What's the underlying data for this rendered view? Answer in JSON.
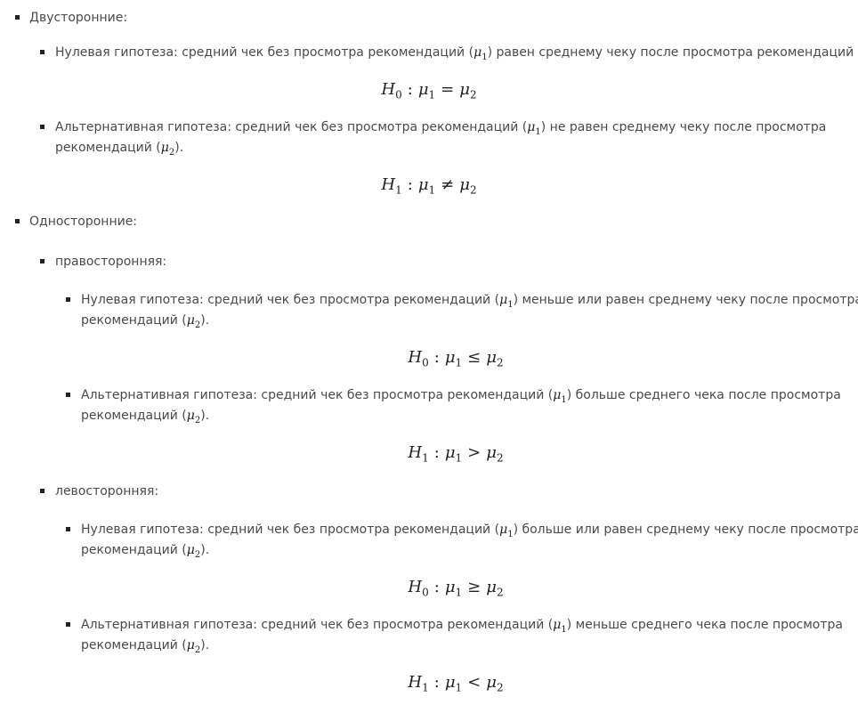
{
  "two_sided": {
    "heading": "Двусторонние:",
    "null": {
      "a": "Нулевая гипотеза: средний чек без просмотра рекомендаций (",
      "b": ") равен среднему чеку после просмотра рекомендаций (",
      "c": ")."
    },
    "null_formula": {
      "lhs": "H",
      "lhs_sub": "0",
      "colon": ":",
      "op": "=",
      "rhs_sub": "2",
      "mu_sub": "1"
    },
    "alt": {
      "a": "Альтернативная гипотеза: средний чек без просмотра рекомендаций (",
      "b": ") не равен среднему чеку после просмотра",
      "line2a": "рекомендаций (",
      "line2b": ")."
    },
    "alt_formula": {
      "lhs": "H",
      "lhs_sub": "1",
      "colon": ":",
      "op": "≠",
      "rhs_sub": "2",
      "mu_sub": "1"
    }
  },
  "one_sided": {
    "heading": "Односторонние:",
    "right": {
      "heading": "правосторонняя:",
      "null": {
        "a": "Нулевая гипотеза: средний чек без просмотра рекомендаций (",
        "b": ") меньше или равен среднему чеку после просмотра",
        "line2a": "рекомендаций (",
        "line2b": ")."
      },
      "null_formula": {
        "lhs": "H",
        "lhs_sub": "0",
        "colon": ":",
        "op": "≤",
        "rhs_sub": "2",
        "mu_sub": "1"
      },
      "alt": {
        "a": "Альтернативная гипотеза: средний чек без просмотра рекомендаций (",
        "b": ") больше среднего чека после просмотра",
        "line2a": "рекомендаций (",
        "line2b": ")."
      },
      "alt_formula": {
        "lhs": "H",
        "lhs_sub": "1",
        "colon": ":",
        "op": ">",
        "rhs_sub": "2",
        "mu_sub": "1"
      }
    },
    "left": {
      "heading": "левосторонняя:",
      "null": {
        "a": "Нулевая гипотеза: средний чек без просмотра рекомендаций (",
        "b": ") больше или равен среднему чеку после просмотра",
        "line2a": "рекомендаций (",
        "line2b": ")."
      },
      "null_formula": {
        "lhs": "H",
        "lhs_sub": "0",
        "colon": ":",
        "op": "≥",
        "rhs_sub": "2",
        "mu_sub": "1"
      },
      "alt": {
        "a": "Альтернативная гипотеза: средний чек без просмотра рекомендаций (",
        "b": ") меньше среднего чека после просмотра",
        "line2a": "рекомендаций (",
        "line2b": ")."
      },
      "alt_formula": {
        "lhs": "H",
        "lhs_sub": "1",
        "colon": ":",
        "op": "<",
        "rhs_sub": "2",
        "mu_sub": "1"
      }
    }
  },
  "symbols": {
    "mu": "μ"
  }
}
